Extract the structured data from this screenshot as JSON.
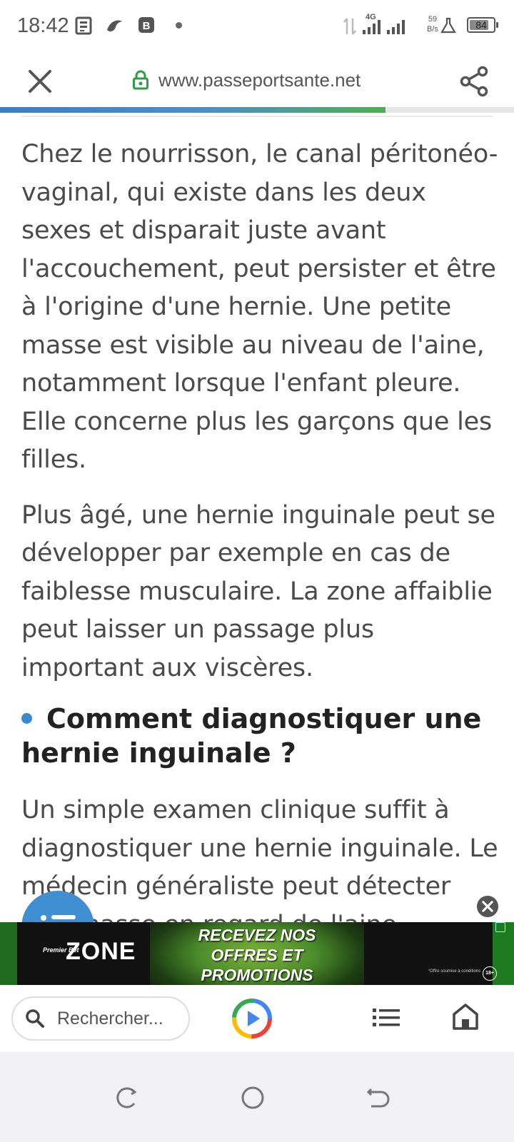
{
  "status_bar": {
    "time": "18:42",
    "network": "4G",
    "speed_value": "59",
    "speed_unit": "B/s",
    "battery": "84",
    "battery_level": 0.84
  },
  "browser": {
    "url": "www.passeportsante.net",
    "page_load_progress": 0.75,
    "close_icon": "close-icon",
    "lock_icon": "lock-icon",
    "share_icon": "share-icon"
  },
  "article": {
    "paragraph_1": "Chez le nourrisson, le canal péritonéo-vaginal, qui existe dans les deux sexes et disparait juste avant l'accouchement, peut persister et être à l'origine d'une hernie. Une petite masse est visible au niveau de l'aine, notamment lorsque l'enfant pleure. Elle concerne plus les garçons que les filles.",
    "paragraph_2": "Plus âgé, une hernie inguinale peut se développer par exemple en cas de faiblesse musculaire. La zone affaiblie peut laisser un passage plus important aux viscères.",
    "heading": "Comment diagnostiquer une hernie inguinale ?",
    "paragraph_3": "Un simple examen clinique suffit à diagnostiquer une hernie inguinale. Le médecin généraliste peut détecter une masse en regard de l'aine"
  },
  "ad": {
    "logo_small": "Premier Bet",
    "logo": "ZONE",
    "headline_1": "RECEVEZ NOS",
    "headline_2": "OFFRES ET",
    "headline_3": "PROMOTIONS",
    "fine_print": "*Offre soumise à conditions",
    "age_badge": "18+"
  },
  "bottom_bar": {
    "search_placeholder": "Rechercher..."
  },
  "colors": {
    "accent_blue": "#3f8fd2",
    "lock_green": "#2e9e44",
    "progress_green": "#4caf50"
  }
}
